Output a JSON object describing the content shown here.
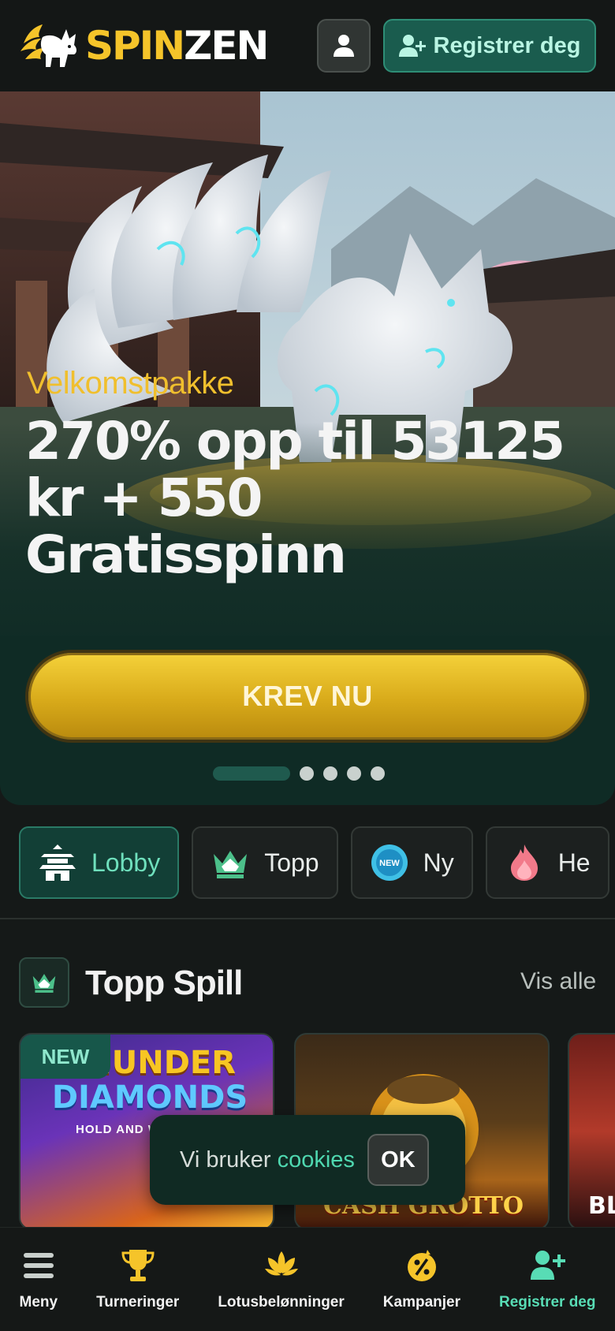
{
  "header": {
    "logo_spin": "SPIN",
    "logo_zen": "ZEN",
    "register_label": "Registrer deg"
  },
  "hero": {
    "kicker": "Velkomstpakke",
    "title_line1": "270% opp til 53125",
    "title_line2": "kr + 550",
    "title_line3": "Gratisspinn",
    "cta_label": "KREV NU",
    "slide_count": 5,
    "active_slide": 1
  },
  "categories": [
    {
      "label": "Lobby",
      "icon": "pagoda-icon",
      "active": true
    },
    {
      "label": "Topp",
      "icon": "crown-icon",
      "active": false
    },
    {
      "label": "Ny",
      "icon": "new-badge-icon",
      "active": false
    },
    {
      "label": "He",
      "icon": "flame-icon",
      "active": false
    }
  ],
  "section": {
    "title": "Topp Spill",
    "see_all": "Vis alle"
  },
  "games": [
    {
      "badge": "NEW",
      "title_line1": "THUNDER",
      "title_line2": "DIAMONDS",
      "subtitle": "HOLD AND WIN"
    },
    {
      "title": "CASH GROTTO"
    },
    {
      "title": "BL"
    }
  ],
  "cookie": {
    "text": "Vi bruker",
    "link": "cookies",
    "ok_label": "OK"
  },
  "bottom_nav": [
    {
      "label": "Meny",
      "icon": "hamburger-menu-icon"
    },
    {
      "label": "Turneringer",
      "icon": "trophy-icon"
    },
    {
      "label": "Lotusbelønninger",
      "icon": "lotus-icon"
    },
    {
      "label": "Kampanjer",
      "icon": "percent-badge-icon"
    },
    {
      "label": "Registrer deg",
      "icon": "add-user-icon"
    }
  ],
  "colors": {
    "brand_gold": "#f5c42a",
    "brand_teal": "#2e8e76",
    "accent_mint": "#58dcb5",
    "background": "#151918"
  }
}
